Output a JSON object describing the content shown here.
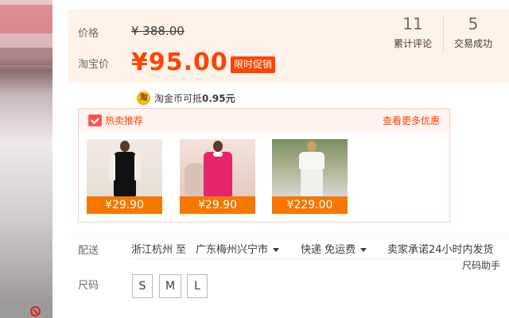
{
  "price": {
    "label": "价格",
    "original": "¥ 388.00",
    "taobao_label": "淘宝价",
    "promo": "¥95.00",
    "badge": "限时促销"
  },
  "stats": [
    {
      "value": "11",
      "label": "累计评论"
    },
    {
      "value": "5",
      "label": "交易成功"
    }
  ],
  "coin": {
    "icon": "taojinbi-coin-icon",
    "glyph": "淘",
    "text": "淘金币可抵",
    "amount": "0.95元"
  },
  "hot": {
    "title": "热卖推荐",
    "more": "查看更多优惠",
    "products": [
      {
        "price": "¥29.90"
      },
      {
        "price": "¥29.90"
      },
      {
        "price": "¥229.00"
      }
    ]
  },
  "shipping": {
    "label": "配送",
    "from": "浙江杭州 至",
    "to": "广东梅州兴宁市",
    "method": "快递 免运费",
    "promise": "卖家承诺24小时内发货"
  },
  "size": {
    "label": "尺码",
    "helper": "尺码助手",
    "options": [
      "S",
      "M",
      "L"
    ]
  },
  "colors": {
    "accent": "#ff4400",
    "badge": "#f57700",
    "panel_bg": "#fff2e8"
  }
}
